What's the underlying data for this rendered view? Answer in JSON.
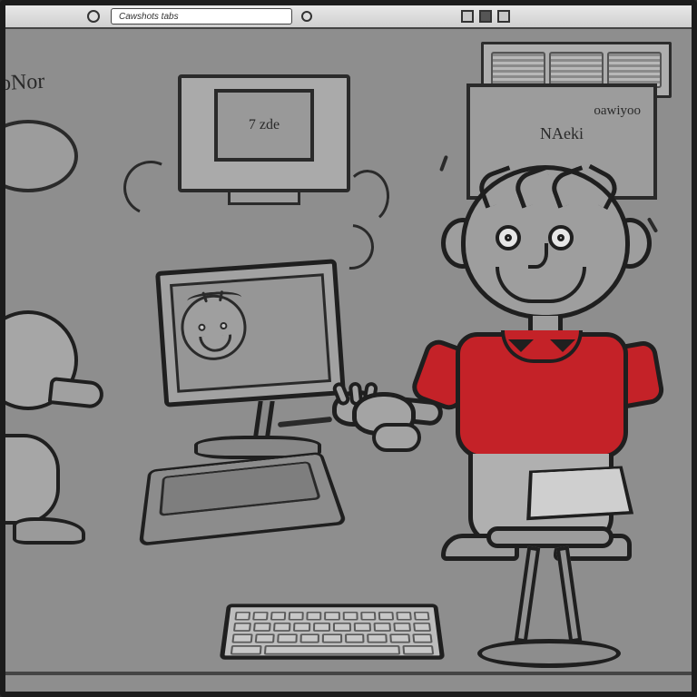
{
  "titlebar": {
    "field_text": "Cawshots tabs"
  },
  "scene": {
    "corner_label": "oNor",
    "wall_tv_label": "7 zde",
    "poster_line1": "oawiyoo",
    "poster_line2": "NAeki"
  },
  "colors": {
    "shirt": "#c42228",
    "line": "#1f1f1f",
    "background": "#8e8e8e"
  }
}
